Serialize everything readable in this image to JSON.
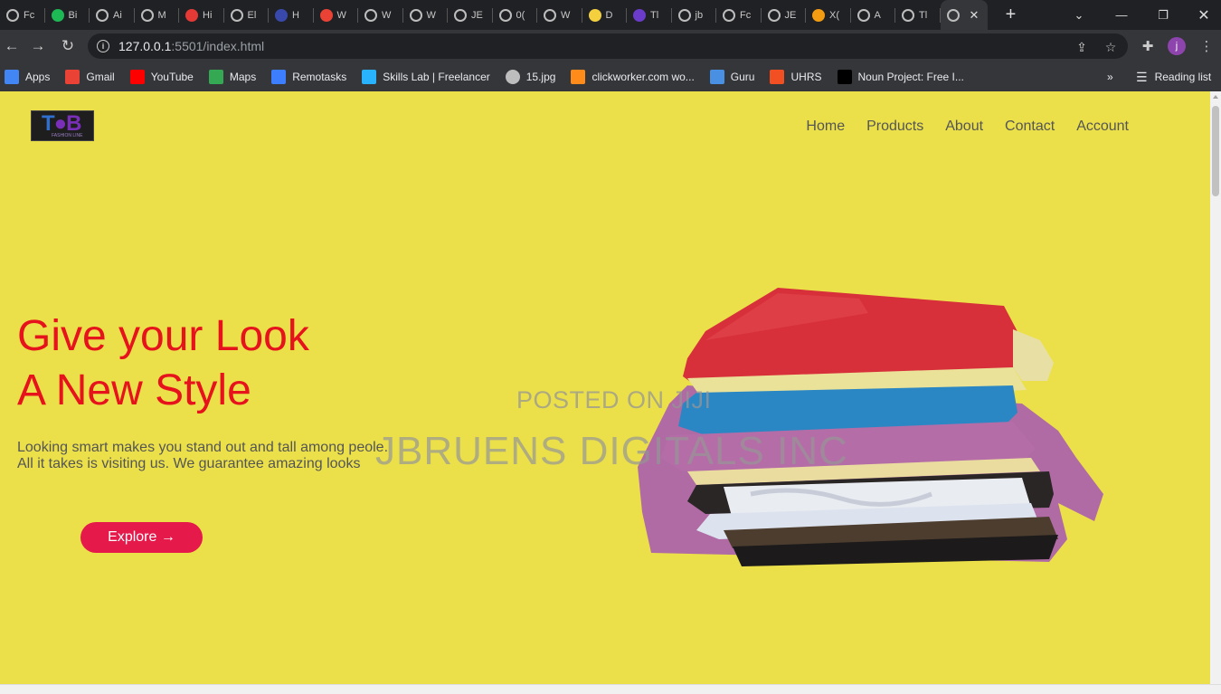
{
  "browser": {
    "tabs": [
      {
        "label": "Fc",
        "icon": "globe-icon"
      },
      {
        "label": "Bi",
        "icon": "green-app-icon",
        "color": "#1db954"
      },
      {
        "label": "Ai",
        "icon": "globe-icon"
      },
      {
        "label": "M",
        "icon": "globe-icon"
      },
      {
        "label": "Hi",
        "icon": "red-x-icon",
        "color": "#e53935"
      },
      {
        "label": "El",
        "icon": "globe-icon"
      },
      {
        "label": "H",
        "icon": "blue-circle-icon",
        "color": "#3949ab"
      },
      {
        "label": "W",
        "icon": "gmail-icon",
        "color": "#ea4335"
      },
      {
        "label": "W",
        "icon": "globe-icon"
      },
      {
        "label": "W",
        "icon": "globe-icon"
      },
      {
        "label": "JE",
        "icon": "globe-icon"
      },
      {
        "label": "0(",
        "icon": "globe-icon"
      },
      {
        "label": "W",
        "icon": "globe-icon"
      },
      {
        "label": "D",
        "icon": "yellow-link-icon",
        "color": "#f4d03f"
      },
      {
        "label": "Tl",
        "icon": "purple-h-icon",
        "color": "#6a3cc9"
      },
      {
        "label": "jb",
        "icon": "globe-icon"
      },
      {
        "label": "Fc",
        "icon": "globe-icon"
      },
      {
        "label": "JE",
        "icon": "globe-icon"
      },
      {
        "label": "X(",
        "icon": "orange-x-icon",
        "color": "#f39c12"
      },
      {
        "label": "A",
        "icon": "globe-icon"
      },
      {
        "label": "Tl",
        "icon": "globe-icon"
      },
      {
        "label": "",
        "icon": "globe-icon",
        "active": true
      }
    ],
    "address": {
      "host": "127.0.0.1",
      "path": ":5501/index.html"
    },
    "bookmarks": [
      {
        "label": "Apps",
        "icon": "apps-grid-icon",
        "color": "#4285f4"
      },
      {
        "label": "Gmail",
        "icon": "gmail-icon",
        "color": "#ea4335"
      },
      {
        "label": "YouTube",
        "icon": "youtube-icon",
        "color": "#ff0000"
      },
      {
        "label": "Maps",
        "icon": "maps-icon",
        "color": "#34a853"
      },
      {
        "label": "Remotasks",
        "icon": "remotasks-icon",
        "color": "#3d7eff"
      },
      {
        "label": "Skills Lab | Freelancer",
        "icon": "freelancer-icon",
        "color": "#29b2fe"
      },
      {
        "label": "15.jpg",
        "icon": "globe-icon",
        "color": "#bdbdbd"
      },
      {
        "label": "clickworker.com wo...",
        "icon": "clickworker-icon",
        "color": "#ff8c1a"
      },
      {
        "label": "Guru",
        "icon": "guru-icon",
        "color": "#4a90e2"
      },
      {
        "label": "UHRS",
        "icon": "microsoft-icon",
        "color": "#f25022"
      },
      {
        "label": "Noun Project: Free I...",
        "icon": "noun-project-icon",
        "color": "#000000"
      }
    ],
    "reading_list": "Reading list",
    "profile_initial": "j"
  },
  "page": {
    "nav": [
      "Home",
      "Products",
      "About",
      "Contact",
      "Account"
    ],
    "hero": {
      "title_line1": "Give your Look",
      "title_line2": "A New Style",
      "text_line1": "Looking smart makes you stand out and tall among peole.",
      "text_line2": "All it takes is visiting us. We guarantee amazing looks",
      "button": "Explore →"
    },
    "watermark_line1": "POSTED ON JIJI",
    "watermark_line2": "JBRUENS DIGITALS INC",
    "colors": {
      "background": "#ebe04a",
      "title": "#e6121c",
      "button": "#e5194a",
      "nav": "#555555"
    }
  }
}
